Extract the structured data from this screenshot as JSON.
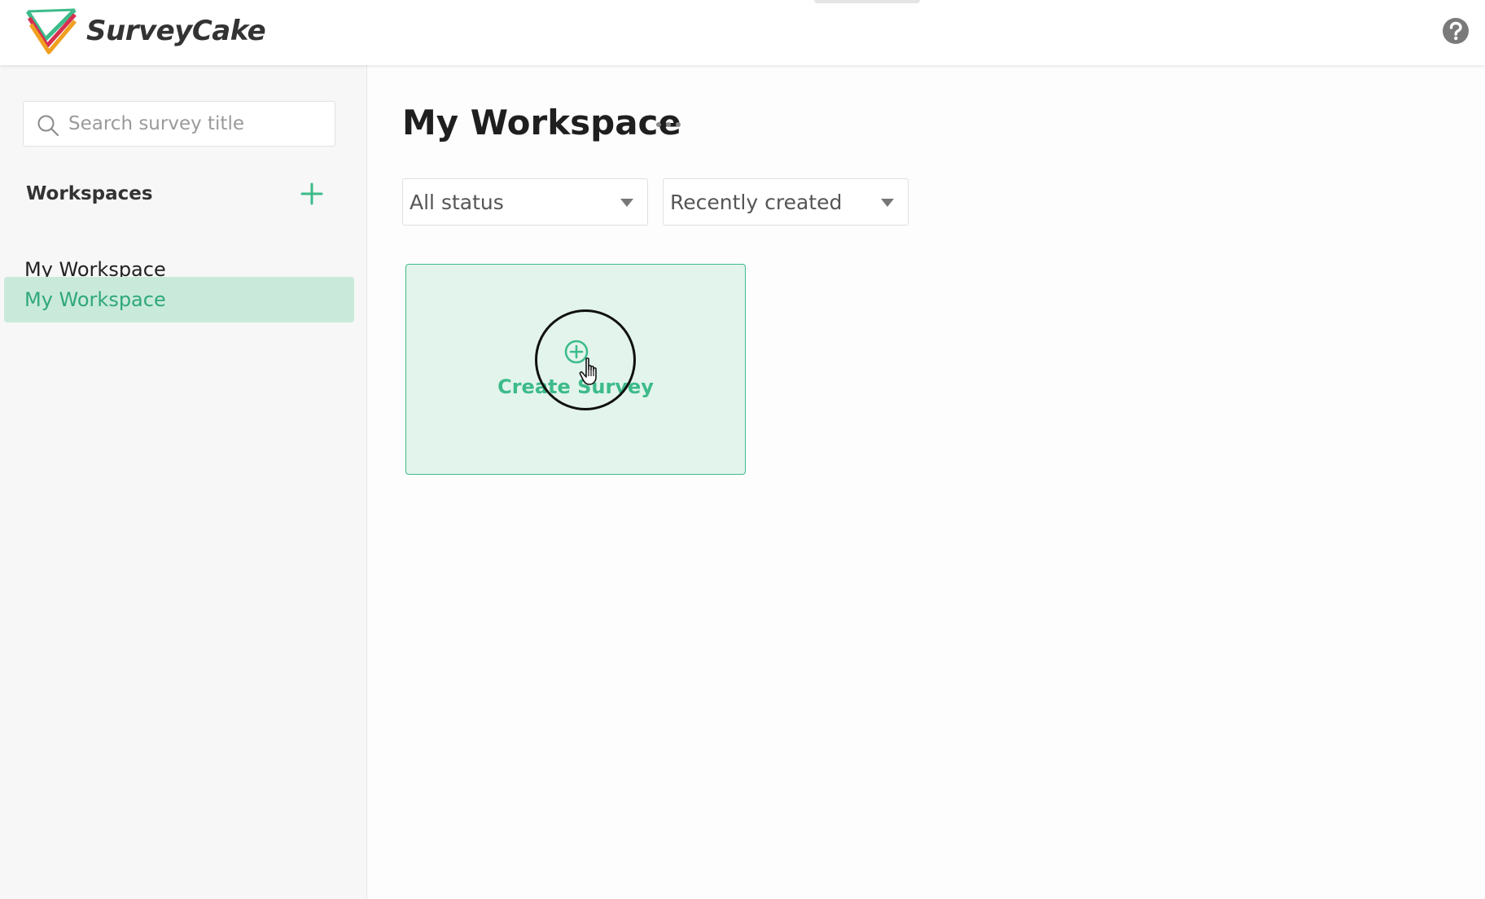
{
  "header": {
    "brand": "SurveyCake"
  },
  "sidebar": {
    "search": {
      "placeholder": "Search survey title",
      "value": ""
    },
    "workspaces_title": "Workspaces",
    "items": [
      {
        "label": "My Workspace",
        "selected": false
      },
      {
        "label": "My Workspace",
        "selected": true
      }
    ]
  },
  "main": {
    "title": "My Workspace",
    "filters": {
      "status": "All status",
      "sort": "Recently created"
    },
    "create_card": {
      "label": "Create Survey"
    }
  },
  "colors": {
    "accent": "#3dbb8a",
    "selected_bg": "#c9eadb",
    "card_bg": "#e2f4ec"
  },
  "icons": [
    "logo-icon",
    "help-icon",
    "search-icon",
    "plus-icon",
    "more-icon",
    "caret-down-icon",
    "plus-circle-icon",
    "hand-cursor-icon"
  ]
}
